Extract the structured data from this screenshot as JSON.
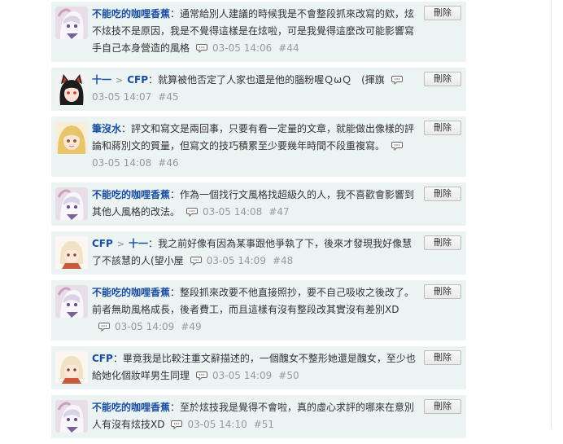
{
  "comments": [
    {
      "author": "不能吃的咖哩香蕉",
      "reply_to": "",
      "text": "通常給別人建議的時候我是不會整段抓來改寫的欸，炫不炫技不是原因，我是不覺得這樣是在炫啦，可是我覺得這麼改可能影響寫手自己本身營造的風格",
      "time": "03-05 14:06",
      "floor": "#44",
      "avatar": "white-hair-character",
      "delete_label": "刪除"
    },
    {
      "author": "十一",
      "reply_to": "CFP",
      "text": "就算被他否定了人家也還是他的腦粉喔ＱωＱ　(揮旗",
      "time": "03-05 14:07",
      "floor": "#45",
      "avatar": "cat-ear-character",
      "delete_label": "刪除"
    },
    {
      "author": "筆沒水",
      "reply_to": "",
      "text": "評文和寫文是兩回事，只要有看一定量的文章，就能做出像樣的評論和蔣別文的質量，但寫文的技巧積累至少要幾年時間不段重複寫。",
      "time": "03-05 14:08",
      "floor": "#46",
      "avatar": "blonde-character",
      "delete_label": "刪除"
    },
    {
      "author": "不能吃的咖哩香蕉",
      "reply_to": "",
      "text": "作為一個找行文風格找超級久的人，我不喜歡會影響到其他人風格的改法。",
      "time": "03-05 14:08",
      "floor": "#47",
      "avatar": "white-hair-character",
      "delete_label": "刪除"
    },
    {
      "author": "CFP",
      "reply_to": "十一",
      "text": "我之前好像有因為某事跟他爭執了下，後來才發現我好像慧了不該慧的人(望小屋",
      "time": "03-05 14:09",
      "floor": "#48",
      "avatar": "light-hair-character",
      "delete_label": "刪除"
    },
    {
      "author": "不能吃的咖哩香蕉",
      "reply_to": "",
      "text": "整段抓來改要不他直接照抄，要不自己吸收之後改了。前者無助風格成長，後者費工，而且這樣有沒有整段改其實沒有差別XD",
      "time": "03-05 14:09",
      "floor": "#49",
      "avatar": "white-hair-character",
      "delete_label": "刪除"
    },
    {
      "author": "CFP",
      "reply_to": "",
      "text": "畢竟我是比較注重文辭描述的，一個醜女不整形她還是醜女，至少也給她化個妝咩男生同理",
      "time": "03-05 14:09",
      "floor": "#50",
      "avatar": "light-hair-character",
      "delete_label": "刪除"
    },
    {
      "author": "不能吃的咖哩香蕉",
      "reply_to": "",
      "text": "至於炫技我是覺得不會啦，真的虛心求評的哪來在意別人有沒有炫技XD",
      "time": "03-05 14:10",
      "floor": "#51",
      "avatar": "white-hair-character",
      "delete_label": "刪除"
    }
  ],
  "icons": {
    "reply": "speech-bubble-icon",
    "arrow": "arrow-right-icon"
  },
  "colors": {
    "row_bg": "#ebf3f3",
    "author": "#1a4ea0",
    "meta": "#999999"
  }
}
